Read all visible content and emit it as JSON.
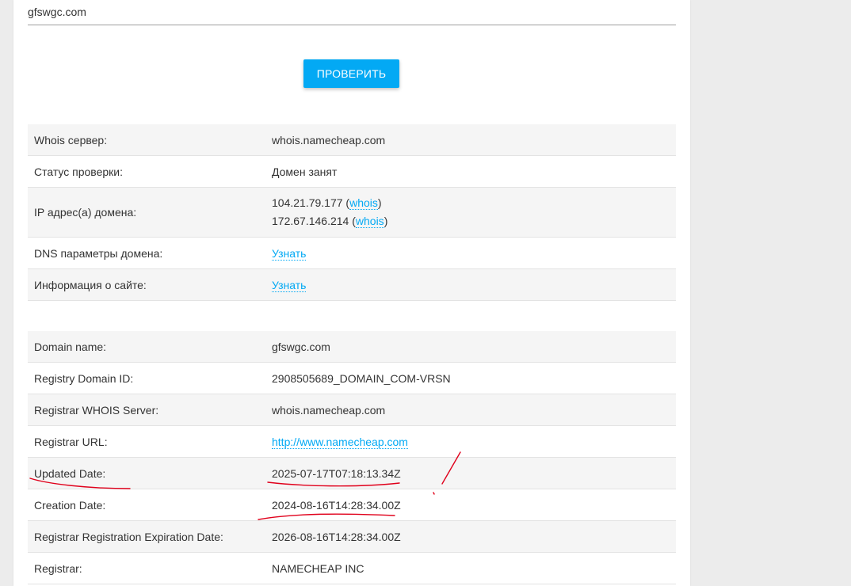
{
  "search": {
    "domain_value": "gfswgc.com"
  },
  "check_button_label": "ПРОВЕРИТЬ",
  "check_table": {
    "whois_server": {
      "label": "Whois сервер:",
      "value": "whois.namecheap.com"
    },
    "status": {
      "label": "Статус проверки:",
      "value": "Домен занят"
    },
    "ip": {
      "label": "IP адрес(а) домена:",
      "entries": [
        {
          "ip": "104.21.79.177",
          "link": "whois"
        },
        {
          "ip": "172.67.146.214",
          "link": "whois"
        }
      ]
    },
    "dns": {
      "label": "DNS параметры домена:",
      "link": "Узнать"
    },
    "site_info": {
      "label": "Информация о сайте:",
      "link": "Узнать"
    }
  },
  "whois_table": {
    "domain_name": {
      "label": "Domain name:",
      "value": "gfswgc.com"
    },
    "registry_id": {
      "label": "Registry Domain ID:",
      "value": "2908505689_DOMAIN_COM-VRSN"
    },
    "registrar_whois": {
      "label": "Registrar WHOIS Server:",
      "value": "whois.namecheap.com"
    },
    "registrar_url": {
      "label": "Registrar URL:",
      "value": "http://www.namecheap.com"
    },
    "updated": {
      "label": "Updated Date:",
      "value": "2025-07-17T07:18:13.34Z"
    },
    "creation": {
      "label": "Creation Date:",
      "value": "2024-08-16T14:28:34.00Z"
    },
    "expiration": {
      "label": "Registrar Registration Expiration Date:",
      "value": "2026-08-16T14:28:34.00Z"
    },
    "registrar": {
      "label": "Registrar:",
      "value": "NAMECHEAP INC"
    }
  },
  "colors": {
    "accent": "#03a9f4",
    "annotation": "#e0001b",
    "row_stripe": "#f5f5f5",
    "background": "#ececec"
  }
}
